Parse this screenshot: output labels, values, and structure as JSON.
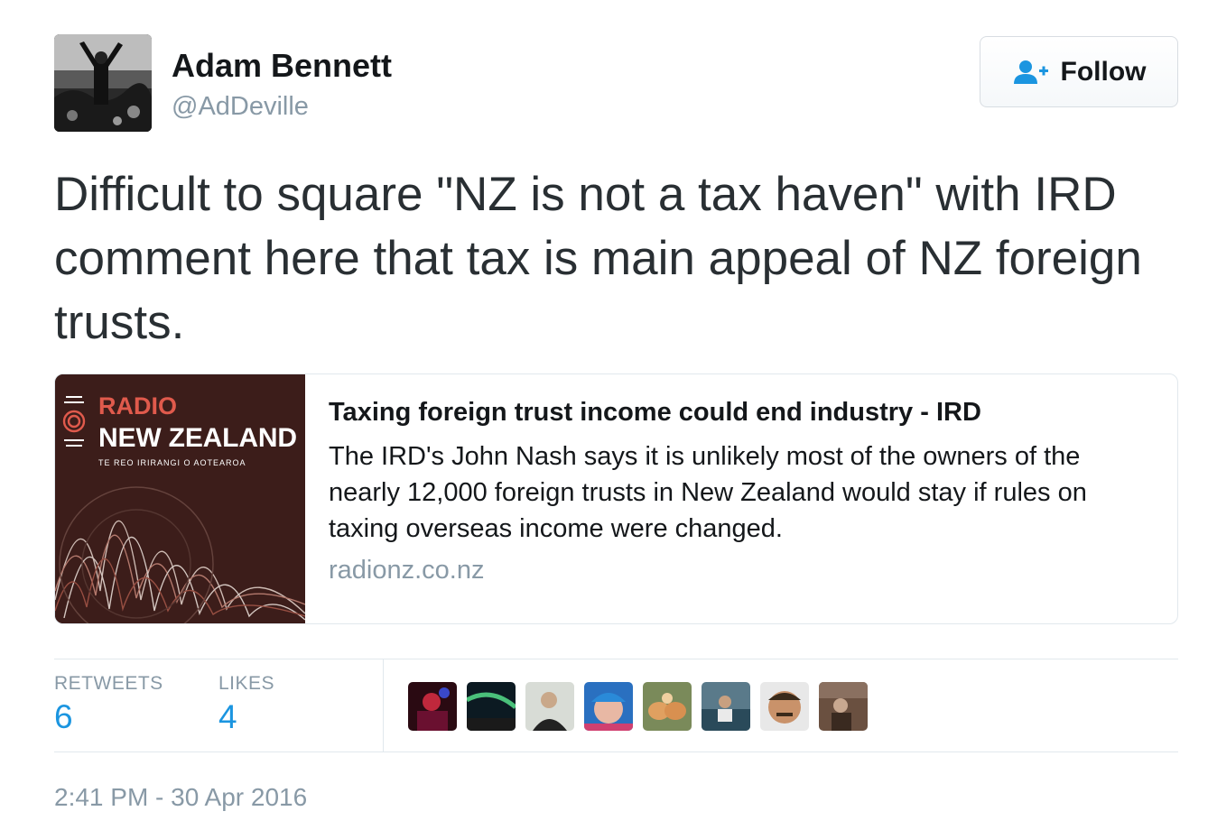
{
  "author": {
    "name": "Adam Bennett",
    "handle": "@AdDeville"
  },
  "follow_button": {
    "label": "Follow",
    "icon": "add-user-icon"
  },
  "tweet": {
    "text": "Difficult to square \"NZ is not a tax haven\" with IRD comment here that tax is main appeal of NZ foreign trusts."
  },
  "card": {
    "image": {
      "brand_line1": "RADIO",
      "brand_line2": "NEW ZEALAND",
      "tagline": "TE REO IRIRANGI O AOTEAROA"
    },
    "title": "Taxing foreign trust income could end industry - IRD",
    "description": "The IRD's John Nash says it is unlikely most of the owners of the nearly 12,000 foreign trusts in New Zealand would stay if rules on taxing overseas income were changed.",
    "domain": "radionz.co.nz"
  },
  "stats": {
    "retweets_label": "RETWEETS",
    "retweets_value": "6",
    "likes_label": "LIKES",
    "likes_value": "4"
  },
  "likers": [
    {
      "name": "liker-avatar-1"
    },
    {
      "name": "liker-avatar-2"
    },
    {
      "name": "liker-avatar-3"
    },
    {
      "name": "liker-avatar-4"
    },
    {
      "name": "liker-avatar-5"
    },
    {
      "name": "liker-avatar-6"
    },
    {
      "name": "liker-avatar-7"
    },
    {
      "name": "liker-avatar-8"
    }
  ],
  "timestamp": "2:41 PM - 30 Apr 2016",
  "colors": {
    "link_blue": "#1b95e0",
    "muted": "#8899a6",
    "text": "#14171a",
    "rnz_red": "#e05a4c",
    "card_image_bg": "#3c1d1a"
  }
}
